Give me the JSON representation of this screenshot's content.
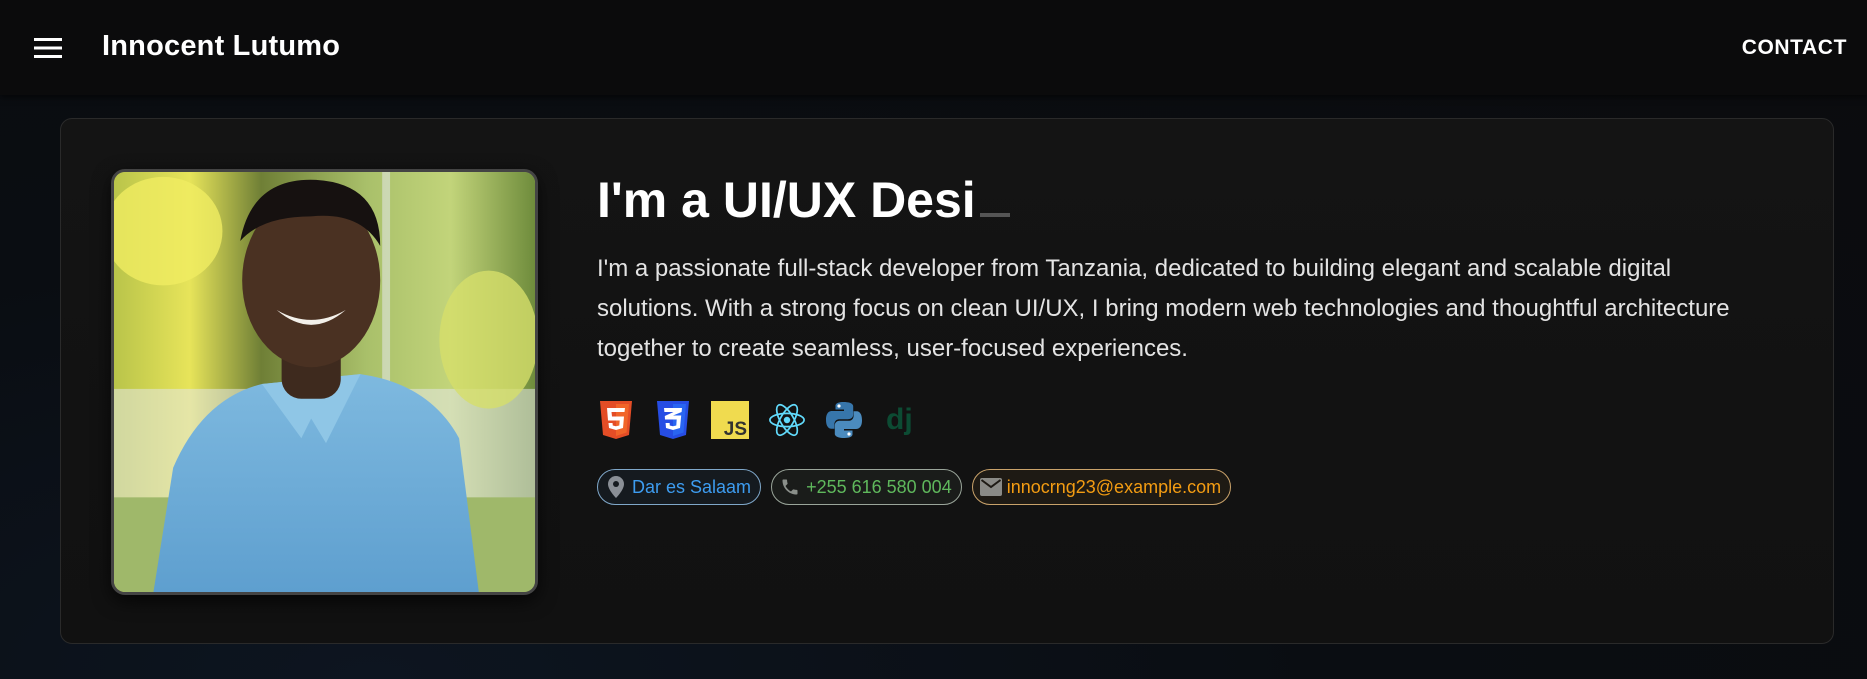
{
  "appbar": {
    "brand": "Innocent Lutumo",
    "contact_label": "CONTACT",
    "menu_icon": "hamburger-menu-icon"
  },
  "hero": {
    "photo_alt": "Portrait of Innocent Lutumo",
    "headline": "I'm a UI/UX Desi",
    "bio": "I'm a passionate full-stack developer from Tanzania, dedicated to building elegant and scalable digital solutions. With a strong focus on clean UI/UX, I bring modern web technologies and thoughtful architecture together to create seamless, user-focused experiences.",
    "tech_icons": [
      "html5-icon",
      "css3-icon",
      "javascript-icon",
      "react-icon",
      "python-icon",
      "django-icon"
    ],
    "chips": {
      "location": "Dar es Salaam",
      "phone": "+255 616 580 004",
      "email": "innocrng23@example.com"
    }
  },
  "colors": {
    "location": "#3d9cf0",
    "phone": "#5fb85c",
    "email": "#f39c12",
    "html5": "#e44d26",
    "css3": "#264de4",
    "javascript": "#f0db4f",
    "react": "#61dafb",
    "python": "#3776ab",
    "django": "#0c4b33"
  }
}
